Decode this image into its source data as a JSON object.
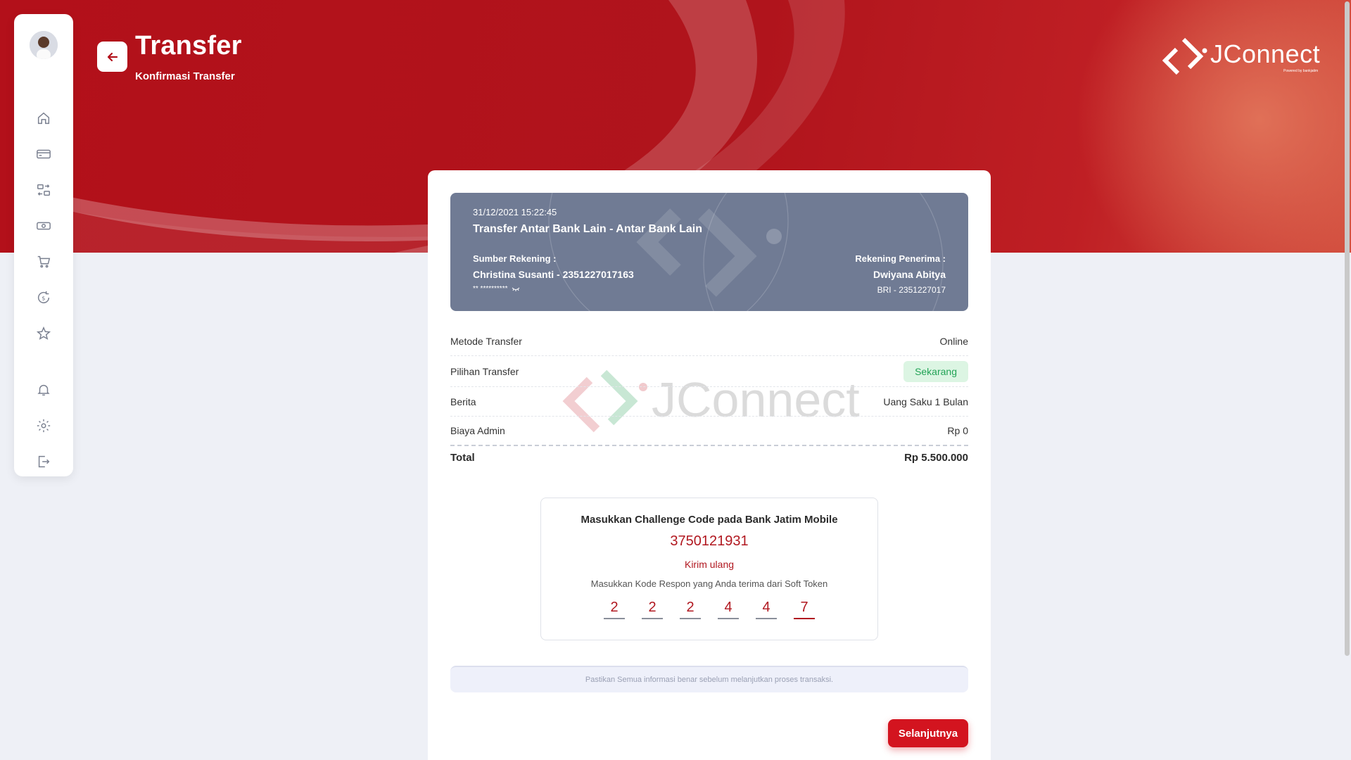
{
  "app": {
    "brand": "JConnect",
    "brand_sub": "Powered by bankjatim"
  },
  "header": {
    "title": "Transfer",
    "subtitle": "Konfirmasi Transfer"
  },
  "sidebar": {
    "items": [
      {
        "icon": "home-icon"
      },
      {
        "icon": "card-icon"
      },
      {
        "icon": "transfer-icon"
      },
      {
        "icon": "cash-icon"
      },
      {
        "icon": "cart-icon"
      },
      {
        "icon": "payment-icon"
      },
      {
        "icon": "star-icon"
      },
      {
        "icon": "bell-icon"
      },
      {
        "icon": "gear-icon"
      },
      {
        "icon": "logout-icon"
      }
    ]
  },
  "summary": {
    "datetime": "31/12/2021 15:22:45",
    "type": "Transfer Antar Bank Lain - Antar Bank Lain",
    "source_label": "Sumber Rekening :",
    "source_value": "Christina Susanti - 2351227017163",
    "source_masked": "** **********",
    "recipient_label": "Rekening Penerima :",
    "recipient_name": "Dwiyana Abitya",
    "recipient_account": "BRI - 2351227017"
  },
  "details": {
    "rows": [
      {
        "label": "Metode Transfer",
        "value": "Online"
      },
      {
        "label": "Pilihan Transfer",
        "value": "Sekarang"
      },
      {
        "label": "Berita",
        "value": "Uang Saku 1 Bulan"
      },
      {
        "label": "Biaya Admin",
        "value": "Rp 0"
      }
    ],
    "total_label": "Total",
    "total_value": "Rp 5.500.000"
  },
  "challenge": {
    "title": "Masukkan Challenge Code pada Bank Jatim Mobile",
    "code": "3750121931",
    "resend": "Kirim ulang",
    "hint": "Masukkan Kode Respon yang Anda terima dari Soft Token",
    "otp": [
      "2",
      "2",
      "2",
      "4",
      "4",
      "7"
    ]
  },
  "notice": "Pastikan Semua informasi benar sebelum melanjutkan proses transaksi.",
  "actions": {
    "next": "Selanjutnya"
  },
  "colors": {
    "primary": "#b3101a",
    "accent_red": "#d3141f",
    "summary_bg": "#707b94",
    "success_bg": "#dcf5e3",
    "success_text": "#22a356"
  }
}
